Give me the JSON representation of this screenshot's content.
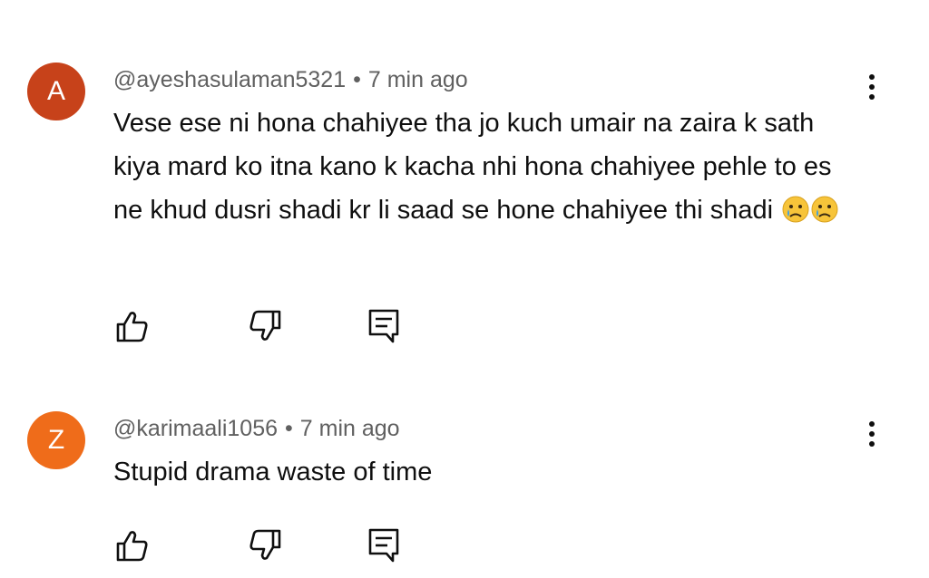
{
  "comments": [
    {
      "avatar_letter": "A",
      "avatar_color": "#c7421a",
      "username": "@ayeshasulaman5321",
      "separator": "•",
      "time": "7 min ago",
      "text": "Vese ese ni hona chahiyee tha jo kuch umair na zaira k sath kiya mard ko itna kano k kacha nhi hona chahiyee pehle to es ne khud dusri shadi kr li saad se hone chahiyee thi shadi",
      "emojis": [
        "crying-face",
        "crying-face"
      ]
    },
    {
      "avatar_letter": "Z",
      "avatar_color": "#ef6c1a",
      "username": "@karimaali1056",
      "separator": "•",
      "time": "7 min ago",
      "text": "Stupid drama waste of time",
      "emojis": []
    }
  ],
  "icons": {
    "like": "thumbs-up-icon",
    "dislike": "thumbs-down-icon",
    "reply": "reply-icon",
    "more": "more-vert-icon"
  }
}
